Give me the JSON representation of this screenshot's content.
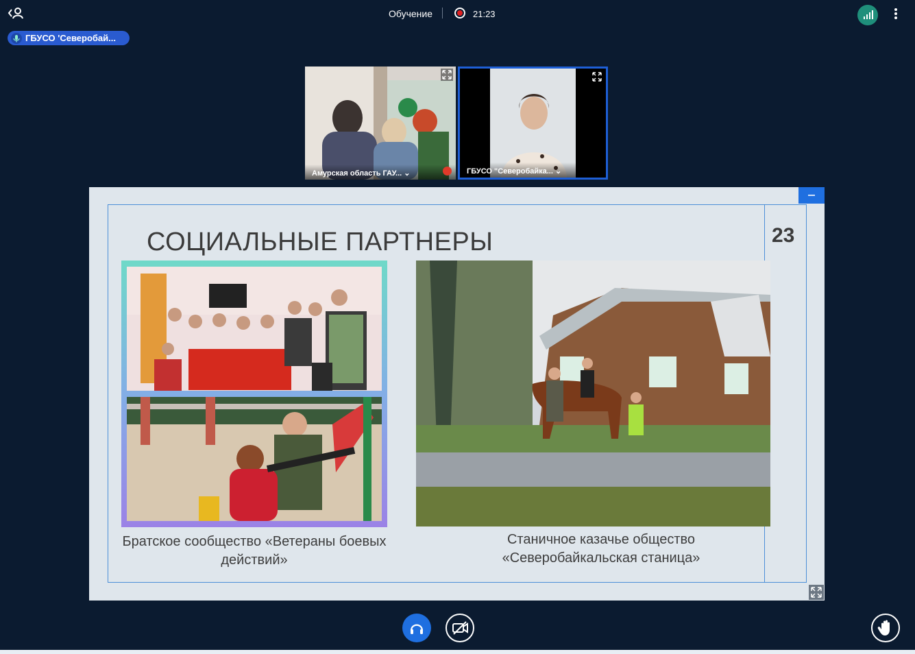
{
  "header": {
    "title": "Обучение",
    "recording_time": "21:23"
  },
  "active_speaker": {
    "name": "ГБУСО 'Северобай..."
  },
  "participants": [
    {
      "label": "Амурская область ГАУ..."
    },
    {
      "label": "ГБУСО \"Северобайка..."
    }
  ],
  "slide": {
    "title": "СОЦИАЛЬНЫЕ ПАРТНЕРЫ",
    "number": "23",
    "caption_left": "Братское сообщество «Ветераны боевых действий»",
    "caption_right": "Станичное казачье общество «Северобайкальская станица»"
  },
  "colors": {
    "background": "#0b1b30",
    "accent": "#1f6fe0",
    "signal": "#1f8f7b",
    "slide_bg": "#dfe6ec"
  },
  "icons": [
    "back-user-icon",
    "record-icon",
    "signal-icon",
    "more-vertical-icon",
    "mic-icon",
    "expand-icon",
    "muted-mic-icon",
    "minimize-icon",
    "headphones-icon",
    "video-off-icon",
    "raise-hand-icon"
  ]
}
